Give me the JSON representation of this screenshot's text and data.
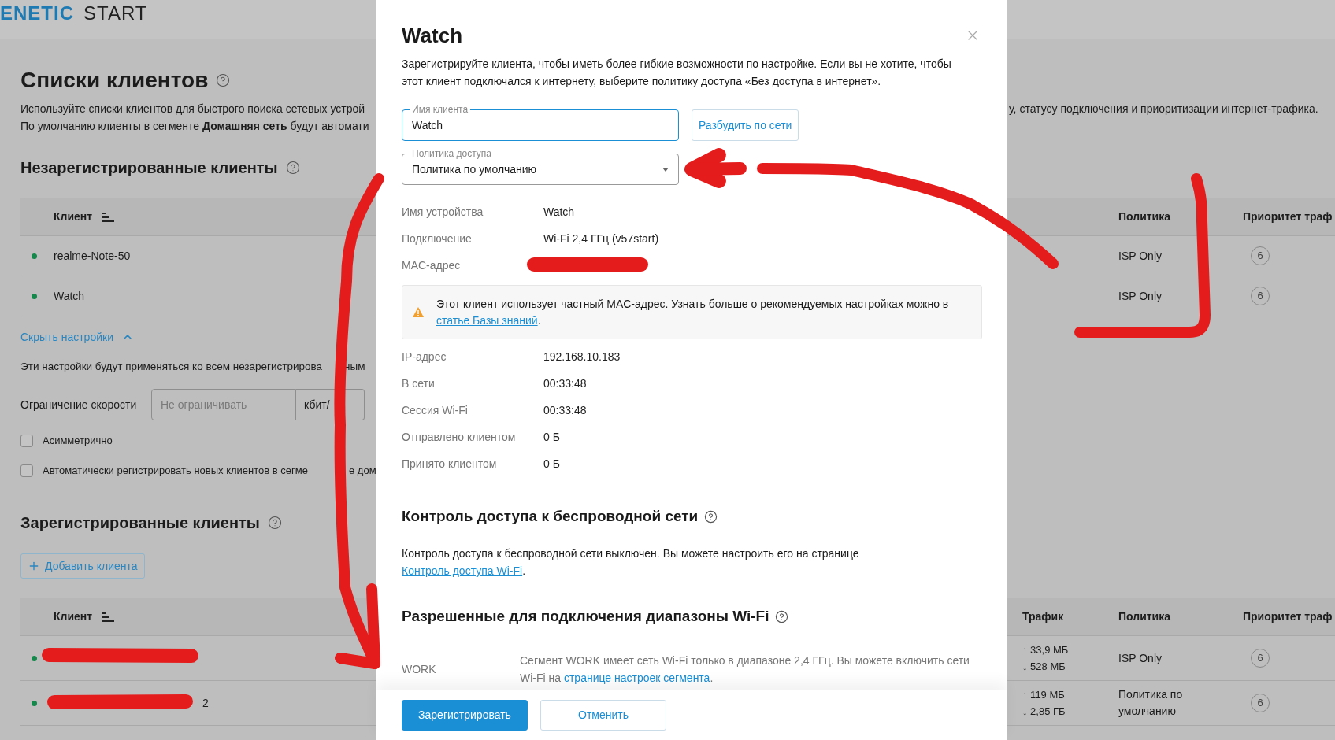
{
  "logo": {
    "brand": "ENETIC",
    "product": "START"
  },
  "page": {
    "title": "Списки клиентов",
    "description": [
      "Используйте списки клиентов для быстрого поиска сетевых устрой",
      "По умолчанию клиенты в сегменте **Домашняя сеть** будут автомати"
    ],
    "description_right": "у, статусу подключения и приоритизации интернет-трафика."
  },
  "unregistered": {
    "title": "Незарегистрированные клиенты",
    "columns": [
      "Клиент",
      "Политика",
      "Приоритет траф"
    ],
    "rows": [
      {
        "client": "realme-Note-50",
        "online": true,
        "policy": "ISP Only",
        "priority": "6"
      },
      {
        "client": "Watch",
        "online": true,
        "policy": "ISP Only",
        "priority": "6"
      }
    ],
    "hide_settings": "Скрыть настройки",
    "settings_note": [
      "Эти настройки будут применяться ко всем незарегистрирова",
      "ным"
    ],
    "speed_limit": {
      "label": "Ограничение скорости",
      "placeholder": "Не ограничивать",
      "unit": "кбит/"
    },
    "options": [
      {
        "label": [
          "Асимметрично"
        ],
        "checked": false
      },
      {
        "label": [
          "Автоматически регистрировать новых клиентов в сегме",
          "е дом"
        ],
        "checked": false
      }
    ]
  },
  "registered": {
    "title": "Зарегистрированные клиенты",
    "add_button": "Добавить клиента",
    "columns": [
      "Клиент",
      "Трафик",
      "Политика",
      "Приоритет траф"
    ],
    "rows": [
      {
        "online": true,
        "sent": "↑ 33,9 МБ",
        "received": "↓ 528 МБ",
        "policy": "ISP Only",
        "priority": "6"
      },
      {
        "online": true,
        "client": "2",
        "sent": "↑ 119 МБ",
        "received": "↓ 2,85 ГБ",
        "policy": "Политика по умолчанию",
        "priority": "6"
      }
    ]
  },
  "modal": {
    "title": "Watch",
    "description": "Зарегистрируйте клиента, чтобы иметь более гибкие возможности по настройке. Если вы не хотите, чтобы этот клиент подключался к интернету, выберите политику доступа «Без доступа в интернет».",
    "name_field": {
      "label": "Имя клиента",
      "value": "Watch",
      "focused": true
    },
    "wake_button": "Разбудить по сети",
    "policy_field": {
      "label": "Политика доступа",
      "value": "Политика по умолчанию"
    },
    "details": [
      {
        "label": "Имя устройства",
        "value": "Watch"
      },
      {
        "label": "Подключение",
        "value": "Wi-Fi 2,4 ГГц (v57start)"
      },
      {
        "label": "MAC-адрес"
      }
    ],
    "warning": {
      "text": "Этот клиент использует частный MAC-адрес. Узнать больше о рекомендуемых настройках можно в",
      "link": "статье Базы знаний",
      "end": "."
    },
    "stats": [
      {
        "label": "IP-адрес",
        "value": "192.168.10.183"
      },
      {
        "label": "В сети",
        "value": "00:33:48"
      },
      {
        "label": "Сессия Wi-Fi",
        "value": "00:33:48"
      },
      {
        "label": "Отправлено клиентом",
        "value": "0 Б"
      },
      {
        "label": "Принято клиентом",
        "value": "0 Б"
      }
    ],
    "access_control": {
      "title": "Контроль доступа к беспроводной сети",
      "text": "Контроль доступа к беспроводной сети выключен. Вы можете настроить его на странице",
      "link": "Контроль доступа Wi-Fi",
      "end": "."
    },
    "bands": {
      "title": "Разрешенные для подключения диапазоны Wi-Fi",
      "rows": [
        {
          "segment": "WORK",
          "text": "Сегмент WORK имеет сеть Wi-Fi только в диапазоне 2,4 ГГц. Вы можете включить сети Wi-Fi на",
          "link": "странице настроек сегмента",
          "end": "."
        }
      ]
    },
    "buttons": [
      {
        "label": "Зарегистрировать",
        "kind": "primary"
      },
      {
        "label": "Отменить",
        "kind": "secondary"
      }
    ]
  }
}
